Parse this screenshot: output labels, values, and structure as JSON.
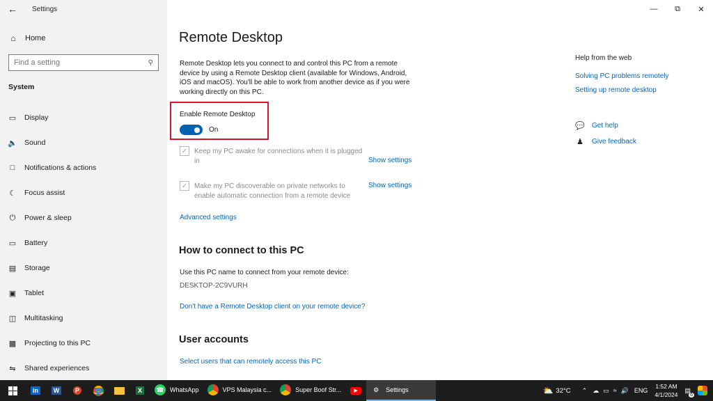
{
  "sidebar": {
    "back_icon": "back-arrow-icon",
    "app_title": "Settings",
    "home_label": "Home",
    "search_placeholder": "Find a setting",
    "section_title": "System",
    "items": [
      {
        "label": "Display",
        "icon": "display-icon"
      },
      {
        "label": "Sound",
        "icon": "sound-icon"
      },
      {
        "label": "Notifications & actions",
        "icon": "notifications-icon"
      },
      {
        "label": "Focus assist",
        "icon": "focus-assist-icon"
      },
      {
        "label": "Power & sleep",
        "icon": "power-icon"
      },
      {
        "label": "Battery",
        "icon": "battery-icon"
      },
      {
        "label": "Storage",
        "icon": "storage-icon"
      },
      {
        "label": "Tablet",
        "icon": "tablet-icon"
      },
      {
        "label": "Multitasking",
        "icon": "multitasking-icon"
      },
      {
        "label": "Projecting to this PC",
        "icon": "projecting-icon"
      },
      {
        "label": "Shared experiences",
        "icon": "shared-experiences-icon"
      }
    ]
  },
  "main": {
    "title": "Remote Desktop",
    "intro": "Remote Desktop lets you connect to and control this PC from a remote device by using a Remote Desktop client (available for Windows, Android, iOS and macOS). You'll be able to work from another device as if you were working directly on this PC.",
    "enable_label": "Enable Remote Desktop",
    "toggle_state": "On",
    "option1_label": "Keep my PC awake for connections when it is plugged in",
    "option2_label": "Make my PC discoverable on private networks to enable automatic connection from a remote device",
    "show_settings": "Show settings",
    "advanced_settings": "Advanced settings",
    "how_to_title": "How to connect to this PC",
    "how_to_text": "Use this PC name to connect from your remote device:",
    "pc_name": "DESKTOP-2C9VURH",
    "no_client_link": "Don't have a Remote Desktop client on your remote device?",
    "user_accounts_title": "User accounts",
    "select_users_link": "Select users that can remotely access this PC"
  },
  "help": {
    "title": "Help from the web",
    "links": [
      "Solving PC problems remotely",
      "Setting up remote desktop"
    ],
    "get_help": "Get help",
    "give_feedback": "Give feedback"
  },
  "taskbar": {
    "apps": [
      {
        "label": "WhatsApp",
        "color": "#25d366"
      },
      {
        "label": "VPS Malaysia c...",
        "color": "#de5246"
      },
      {
        "label": "Super Boof Str...",
        "color": "#de5246"
      },
      {
        "label": "Settings",
        "color": "#444444"
      }
    ],
    "temperature": "32°C",
    "language": "ENG",
    "time": "1:52 AM",
    "date": "4/1/2024",
    "notification_count": "6"
  },
  "colors": {
    "accent": "#0063b1",
    "link": "#0067b8",
    "highlight_box": "#e0102d"
  }
}
